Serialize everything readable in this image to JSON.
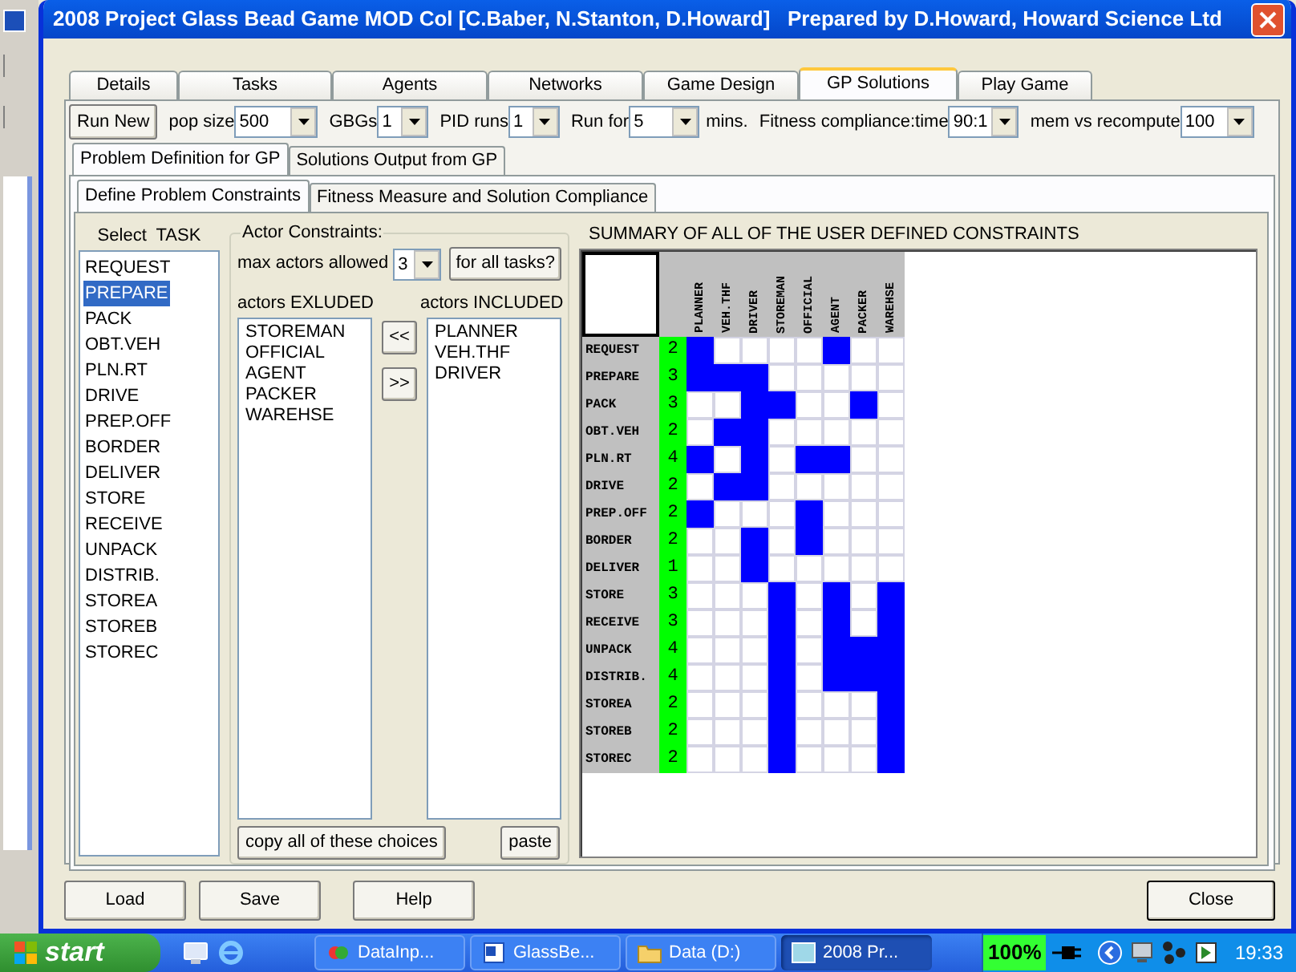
{
  "window": {
    "title": "2008 Project Glass Bead Game MOD Col [C.Baber, N.Stanton, D.Howard]   Prepared by D.Howard, Howard Science Ltd"
  },
  "tabs": [
    {
      "label": "Details",
      "selected": false
    },
    {
      "label": "Tasks",
      "selected": false
    },
    {
      "label": "Agents",
      "selected": false
    },
    {
      "label": "Networks",
      "selected": false
    },
    {
      "label": "Game Design",
      "selected": false
    },
    {
      "label": "GP Solutions",
      "selected": true
    },
    {
      "label": "Play Game",
      "selected": false
    }
  ],
  "run_button": "Run New",
  "controls": [
    {
      "label": "pop size",
      "value": "500"
    },
    {
      "label": "GBGs",
      "value": "1"
    },
    {
      "label": "PID runs",
      "value": "1"
    },
    {
      "label": "Run for",
      "value": "5",
      "suffix": "mins."
    },
    {
      "label": "Fitness compliance:time",
      "value": "90:1"
    },
    {
      "label": "mem vs recompute",
      "value": "100"
    }
  ],
  "subtabs": [
    {
      "label": "Problem Definition for GP",
      "selected": true
    },
    {
      "label": "Solutions Output from GP",
      "selected": false
    }
  ],
  "inner_tabs": [
    {
      "label": "Define Problem Constraints",
      "selected": true
    },
    {
      "label": "Fitness Measure and Solution Compliance",
      "selected": false
    }
  ],
  "task_list": {
    "label": "Select  TASK",
    "items": [
      {
        "label": "REQUEST",
        "selected": false
      },
      {
        "label": "PREPARE",
        "selected": true
      },
      {
        "label": "PACK",
        "selected": false
      },
      {
        "label": "OBT.VEH",
        "selected": false
      },
      {
        "label": "PLN.RT",
        "selected": false
      },
      {
        "label": "DRIVE",
        "selected": false
      },
      {
        "label": "PREP.OFF",
        "selected": false
      },
      {
        "label": "BORDER",
        "selected": false
      },
      {
        "label": "DELIVER",
        "selected": false
      },
      {
        "label": "STORE",
        "selected": false
      },
      {
        "label": "RECEIVE",
        "selected": false
      },
      {
        "label": "UNPACK",
        "selected": false
      },
      {
        "label": "DISTRIB.",
        "selected": false
      },
      {
        "label": "STOREA",
        "selected": false
      },
      {
        "label": "STOREB",
        "selected": false
      },
      {
        "label": "STOREC",
        "selected": false
      }
    ]
  },
  "actor_constraints": {
    "title": "Actor Constraints:",
    "max_label": "max actors allowed",
    "max_value": "3",
    "all_tasks_button": "for all tasks?",
    "excluded_label": "actors EXLUDED",
    "excluded": [
      "STOREMAN",
      "OFFICIAL",
      "AGENT",
      "PACKER",
      "WAREHSE"
    ],
    "included_label": "actors INCLUDED",
    "included": [
      "PLANNER",
      "VEH.THF",
      "DRIVER"
    ],
    "add_button": "<<",
    "remove_button": ">>",
    "copy_button": "copy all of these choices",
    "paste_button": "paste"
  },
  "summary": {
    "title": "SUMMARY OF ALL OF THE USER DEFINED CONSTRAINTS",
    "actors": [
      "PLANNER",
      "VEH.THF",
      "DRIVER",
      "STOREMAN",
      "OFFICIAL",
      "AGENT",
      "PACKER",
      "WAREHSE"
    ],
    "rows": [
      {
        "task": "REQUEST",
        "count": "2",
        "cells": [
          true,
          false,
          false,
          false,
          false,
          true,
          false,
          false
        ]
      },
      {
        "task": "PREPARE",
        "count": "3",
        "cells": [
          true,
          true,
          true,
          false,
          false,
          false,
          false,
          false
        ]
      },
      {
        "task": "PACK",
        "count": "3",
        "cells": [
          false,
          false,
          true,
          true,
          false,
          false,
          true,
          false
        ]
      },
      {
        "task": "OBT.VEH",
        "count": "2",
        "cells": [
          false,
          true,
          true,
          false,
          false,
          false,
          false,
          false
        ]
      },
      {
        "task": "PLN.RT",
        "count": "4",
        "cells": [
          true,
          false,
          true,
          false,
          true,
          true,
          false,
          false
        ]
      },
      {
        "task": "DRIVE",
        "count": "2",
        "cells": [
          false,
          true,
          true,
          false,
          false,
          false,
          false,
          false
        ]
      },
      {
        "task": "PREP.OFF",
        "count": "2",
        "cells": [
          true,
          false,
          false,
          false,
          true,
          false,
          false,
          false
        ]
      },
      {
        "task": "BORDER",
        "count": "2",
        "cells": [
          false,
          false,
          true,
          false,
          true,
          false,
          false,
          false
        ]
      },
      {
        "task": "DELIVER",
        "count": "1",
        "cells": [
          false,
          false,
          true,
          false,
          false,
          false,
          false,
          false
        ]
      },
      {
        "task": "STORE",
        "count": "3",
        "cells": [
          false,
          false,
          false,
          true,
          false,
          true,
          false,
          true
        ]
      },
      {
        "task": "RECEIVE",
        "count": "3",
        "cells": [
          false,
          false,
          false,
          true,
          false,
          true,
          false,
          true
        ]
      },
      {
        "task": "UNPACK",
        "count": "4",
        "cells": [
          false,
          false,
          false,
          true,
          false,
          true,
          true,
          true
        ]
      },
      {
        "task": "DISTRIB.",
        "count": "4",
        "cells": [
          false,
          false,
          false,
          true,
          false,
          true,
          true,
          true
        ]
      },
      {
        "task": "STOREA",
        "count": "2",
        "cells": [
          false,
          false,
          false,
          true,
          false,
          false,
          false,
          true
        ]
      },
      {
        "task": "STOREB",
        "count": "2",
        "cells": [
          false,
          false,
          false,
          true,
          false,
          false,
          false,
          true
        ]
      },
      {
        "task": "STOREC",
        "count": "2",
        "cells": [
          false,
          false,
          false,
          true,
          false,
          false,
          false,
          true
        ]
      }
    ]
  },
  "buttons": [
    "Load",
    "Save",
    "Help"
  ],
  "close_button": "Close",
  "taskbar": {
    "start": "start",
    "tasks": [
      {
        "label": "DataInp...",
        "selected": false
      },
      {
        "label": "GlassBe...",
        "selected": false
      },
      {
        "label": "Data (D:)",
        "selected": false
      },
      {
        "label": "2008 Pr...",
        "selected": true
      }
    ],
    "battery": "100%",
    "clock": "19:33"
  }
}
